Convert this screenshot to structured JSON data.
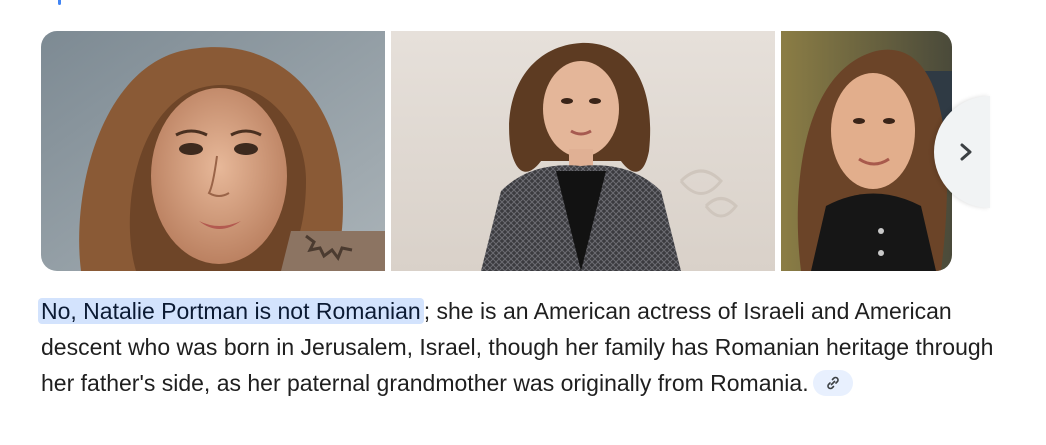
{
  "images": [
    {
      "alt": "Natalie Portman portrait close-up"
    },
    {
      "alt": "Natalie Portman in tweed coat"
    },
    {
      "alt": "Natalie Portman smiling in black jacket"
    }
  ],
  "carousel": {
    "next_icon": "chevron-right-icon"
  },
  "answer": {
    "highlight": "No, Natalie Portman is not Romanian",
    "text": "; she is an American actress of Israeli and American descent who was born in Jerusalem, Israel, though her family has Romanian heritage through her father's side, as her paternal grandmother was originally from Romania.",
    "link_icon": "link-icon"
  }
}
